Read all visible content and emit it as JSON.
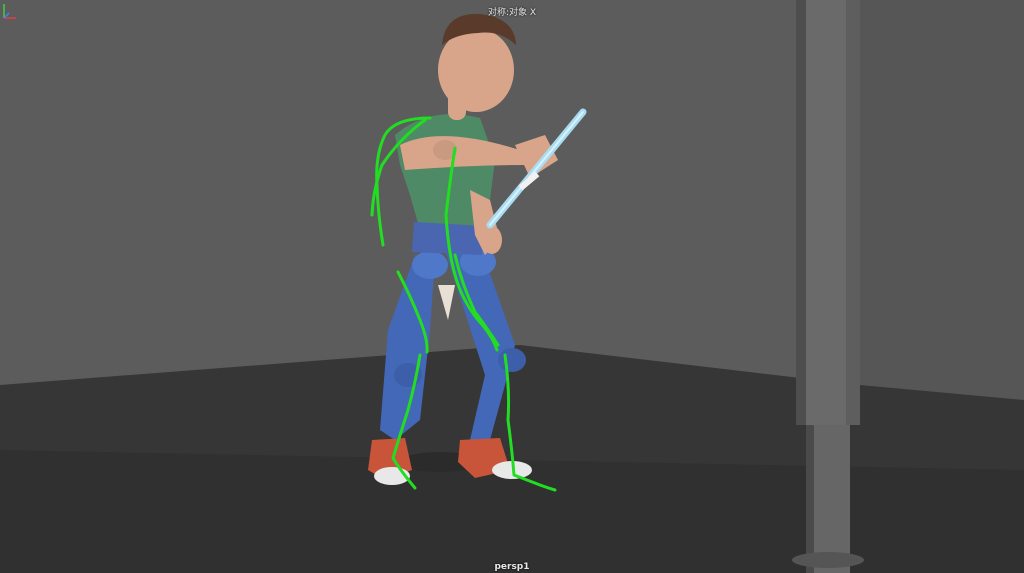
{
  "viewport": {
    "symmetry_label": "对称:对象 X",
    "camera_name": "persp1"
  },
  "colors": {
    "wall": "#5c5c5c",
    "floor": "#363636",
    "motion_trail": "#22dd22",
    "shirt": "#4f8a66",
    "pants": "#4468b8",
    "shoes": "#c8553a",
    "skin": "#d9a58a",
    "hair": "#5a3a2a",
    "sword": "#a8dcf0",
    "pillar": "#6a6a6a"
  },
  "icons": {
    "axis_gizmo": "xyz-axis-icon"
  }
}
